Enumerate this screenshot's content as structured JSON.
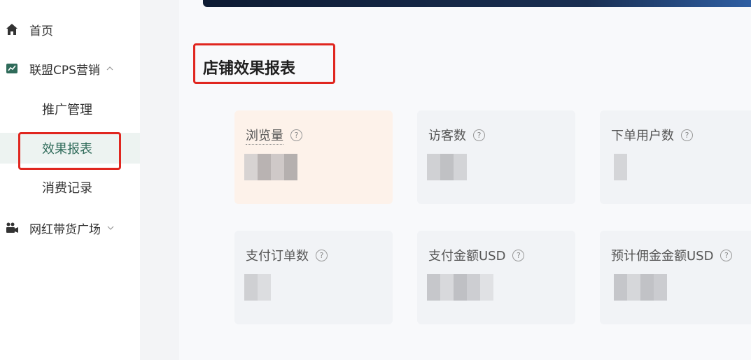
{
  "sidebar": {
    "items": [
      {
        "label": "首页",
        "icon": "home-icon"
      },
      {
        "label": "联盟CPS营销",
        "icon": "chart-icon",
        "expanded": true,
        "children": [
          {
            "label": "推广管理"
          },
          {
            "label": "效果报表",
            "active": true
          },
          {
            "label": "消费记录"
          }
        ]
      },
      {
        "label": "网红带货广场",
        "icon": "video-camera-icon",
        "expanded": false
      }
    ]
  },
  "main": {
    "title": "店铺效果报表",
    "metrics": [
      {
        "label": "浏览量"
      },
      {
        "label": "访客数"
      },
      {
        "label": "下单用户数"
      },
      {
        "label": "支付订单数"
      },
      {
        "label": "支付金额USD"
      },
      {
        "label": "预计佣金金额USD"
      }
    ]
  },
  "colors": {
    "accent": "#2f6b5a",
    "highlight_box": "#e0261f",
    "highlight_card": "#fdf2ea"
  }
}
